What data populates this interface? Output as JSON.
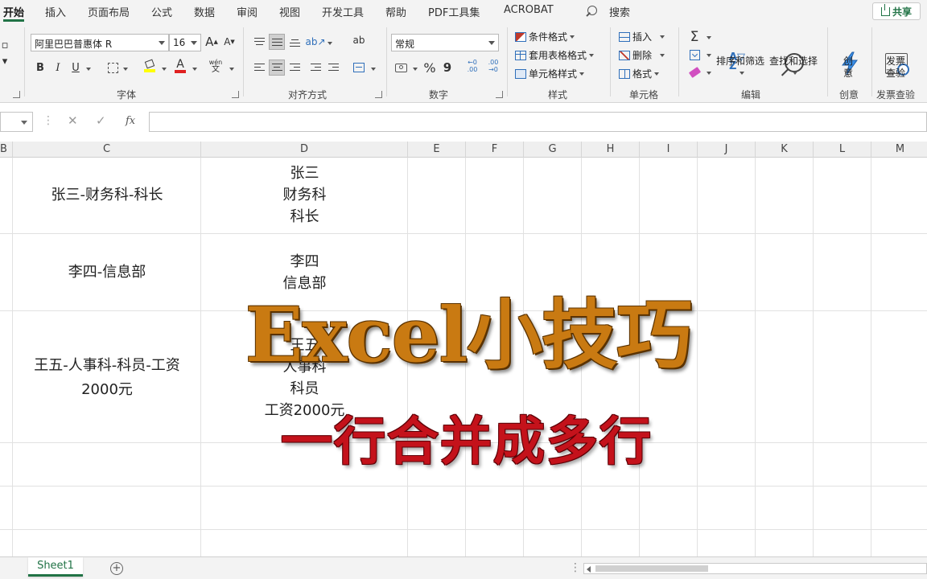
{
  "menu_tabs": [
    "开始",
    "插入",
    "页面布局",
    "公式",
    "数据",
    "审阅",
    "视图",
    "开发工具",
    "帮助",
    "PDF工具集",
    "ACROBAT"
  ],
  "search_label": "搜索",
  "share_label": "共享",
  "ribbon": {
    "font_name": "阿里巴巴普惠体 R",
    "font_size": "16",
    "font_glyphs": {
      "grow": "A",
      "shrink": "A",
      "bold": "B",
      "italic": "I",
      "underline": "U",
      "font_color": "A",
      "phonetic_top": "wén",
      "phonetic_bottom": "文"
    },
    "wrap_glyph": "ab",
    "number_format": "常规",
    "percent_glyph": "%",
    "comma_glyph": "9",
    "dec_inc_glyph": "←0 .00",
    "dec_dec_glyph": ".00 →0",
    "conditional_format": "条件格式",
    "format_as_table": "套用表格格式",
    "cell_styles": "单元格样式",
    "insert": "插入",
    "delete": "删除",
    "format": "格式",
    "sum_glyph": "Σ",
    "sort_filter": "排序和筛选",
    "find_select": "查找和选择",
    "create_top": "创",
    "create_bottom": "意",
    "invoice_top": "发票",
    "invoice_bottom": "查验",
    "groups": {
      "font": "字体",
      "alignment": "对齐方式",
      "number": "数字",
      "styles": "样式",
      "cells": "单元格",
      "editing": "编辑",
      "creative": "创意",
      "invoice": "发票查验"
    }
  },
  "formula_bar": {
    "cancel_glyph": "✕",
    "confirm_glyph": "✓",
    "fx_glyph": "fx",
    "value": ""
  },
  "columns": [
    "B",
    "C",
    "D",
    "E",
    "F",
    "G",
    "H",
    "I",
    "J",
    "K",
    "L",
    "M"
  ],
  "cells": {
    "c1": "张三-财务科-科长",
    "d1": [
      "张三",
      "财务科",
      "科长"
    ],
    "c2": "李四-信息部",
    "d2": [
      "李四",
      "信息部"
    ],
    "c3": [
      "王五-人事科-科员-工资",
      "2000元"
    ],
    "d3": [
      "王五",
      "人事科",
      "科员",
      "工资2000元"
    ]
  },
  "overlay": {
    "title": "Excel小技巧",
    "subtitle": "一行合并成多行"
  },
  "sheet_tab": "Sheet1",
  "add_sheet_glyph": "+",
  "colors": {
    "excel_green": "#217346",
    "title_orange": "#c97a12",
    "subtitle_red": "#c4121b"
  }
}
